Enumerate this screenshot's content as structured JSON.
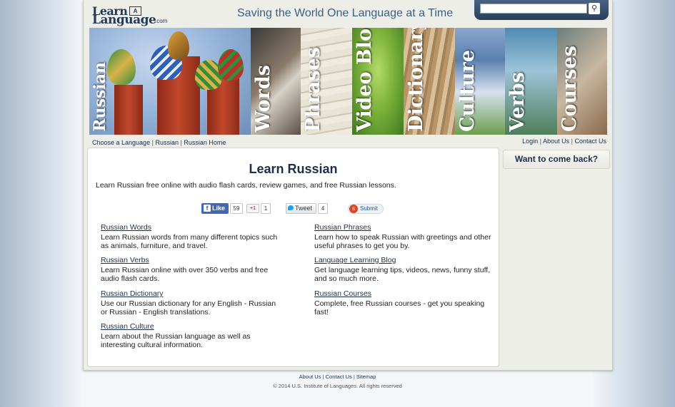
{
  "header": {
    "logo_top": "Learn",
    "logo_box": "A",
    "logo_bottom": "Language",
    "logo_com": ".com",
    "tagline": "Saving the World One Language at a Time",
    "search_placeholder": "",
    "search_icon": "magnifier-icon"
  },
  "banner": {
    "panels": [
      {
        "label": "Russian"
      },
      {
        "label": "Words"
      },
      {
        "label": "Phrases"
      },
      {
        "label": "Video Blog"
      },
      {
        "label": "Dictionary"
      },
      {
        "label": "Culture"
      },
      {
        "label": "Verbs"
      },
      {
        "label": "Courses"
      }
    ]
  },
  "breadcrumb": [
    "Choose a Language",
    "Russian",
    "Russian Home"
  ],
  "top_links": [
    "Login",
    "About Us",
    "Contact Us"
  ],
  "main": {
    "title": "Learn Russian",
    "intro": "Learn Russian free online with audio flash cards, review games, and free Russian lessons.",
    "social": {
      "fb_like": "Like",
      "fb_count": "59",
      "gplus_label": "+1",
      "gplus_count": "1",
      "tweet": "Tweet",
      "tweet_count": "4",
      "submit": "Submit"
    },
    "topics": [
      {
        "title": "Russian Words",
        "desc": "Learn Russian words from many different topics such as animals, furniture, and travel."
      },
      {
        "title": "Russian Phrases",
        "desc": "Learn how to speak Russian with greetings and other useful phrases to get you by."
      },
      {
        "title": "Russian Verbs",
        "desc": "Learn Russian online with over 350 verbs and free audio flash cards."
      },
      {
        "title": "Language Learning Blog",
        "desc": "Get language learning tips, videos, news, funny stuff, and so much more."
      },
      {
        "title": "Russian Dictionary",
        "desc": "Use our Russian dictionary for any English - Russian or Russian - English translations."
      },
      {
        "title": "Russian Courses",
        "desc": "Complete, free Russian courses - get you speaking fast!"
      },
      {
        "title": "Russian Culture",
        "desc": "Learn about the Russian language as well as interesting cultural information."
      }
    ]
  },
  "sidebar": {
    "prompt": "Want to come back?"
  },
  "footer": {
    "links": [
      "About Us",
      "Contact Us",
      "Sitemap"
    ],
    "copyright": "© 2014 U.S. Institute of Languages. All rights reserved"
  },
  "colors": {
    "navy": "#1c2f4a",
    "page_bg": "#eeeee9",
    "fb_blue": "#4267b2"
  }
}
